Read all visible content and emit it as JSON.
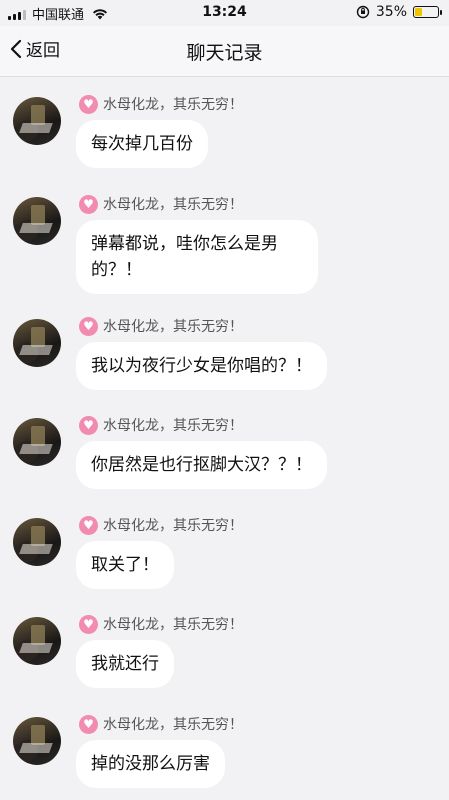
{
  "status_bar": {
    "carrier": "中国联通",
    "time": "13:24",
    "battery_percent": "35%",
    "battery_level": 0.35,
    "battery_color": "#f2c400"
  },
  "nav": {
    "back_label": "返回",
    "title": "聊天记录"
  },
  "sender_icon": "heart-icon",
  "messages": [
    {
      "sender": "水母化龙，其乐无穷！",
      "text": "每次掉几百份"
    },
    {
      "sender": "水母化龙，其乐无穷！",
      "text": "弹幕都说，哇你怎么是男的？！"
    },
    {
      "sender": "水母化龙，其乐无穷！",
      "text": "我以为夜行少女是你唱的？！"
    },
    {
      "sender": "水母化龙，其乐无穷！",
      "text": "你居然是也行抠脚大汉？？！"
    },
    {
      "sender": "水母化龙，其乐无穷！",
      "text": "取关了！"
    },
    {
      "sender": "水母化龙，其乐无穷！",
      "text": "我就还行"
    },
    {
      "sender": "水母化龙，其乐无穷！",
      "text": "掉的没那么厉害"
    }
  ]
}
